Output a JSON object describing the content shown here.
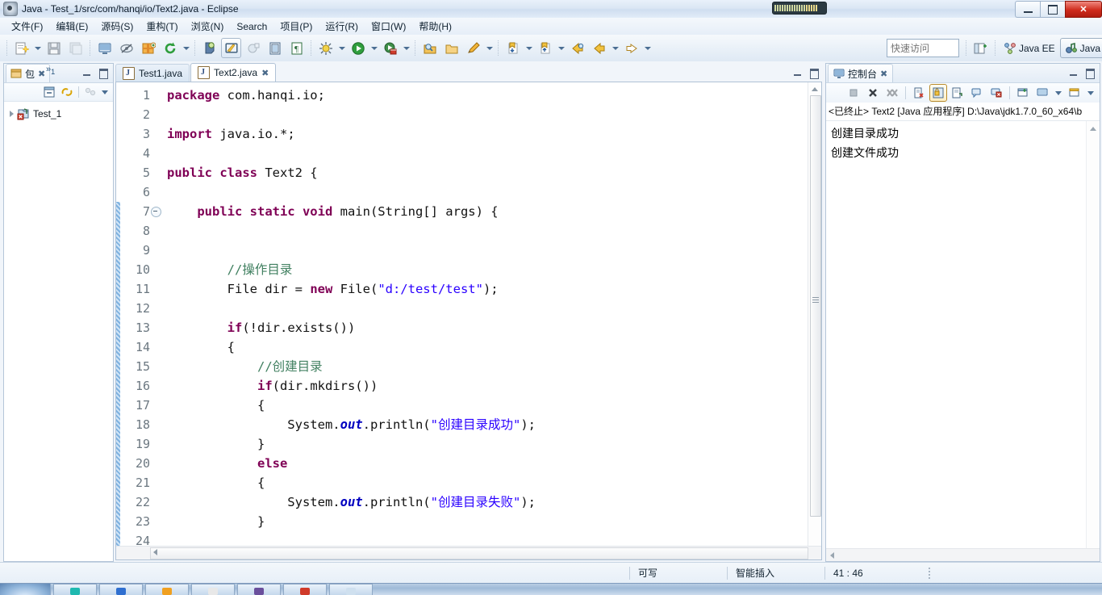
{
  "window": {
    "title": "Java - Test_1/src/com/hanqi/io/Text2.java - Eclipse",
    "app_icon": "eclipse-icon",
    "minimize_label": "Minimize",
    "restore_label": "Restore",
    "close_label": "Close"
  },
  "menubar": {
    "items": [
      {
        "label": "文件(F)",
        "name": "menu-file"
      },
      {
        "label": "编辑(E)",
        "name": "menu-edit"
      },
      {
        "label": "源码(S)",
        "name": "menu-source"
      },
      {
        "label": "重构(T)",
        "name": "menu-refactor"
      },
      {
        "label": "浏览(N)",
        "name": "menu-navigate"
      },
      {
        "label": "Search",
        "name": "menu-search"
      },
      {
        "label": "项目(P)",
        "name": "menu-project"
      },
      {
        "label": "运行(R)",
        "name": "menu-run"
      },
      {
        "label": "窗口(W)",
        "name": "menu-window"
      },
      {
        "label": "帮助(H)",
        "name": "menu-help"
      }
    ]
  },
  "toolbar": {
    "quick_access_placeholder": "快速访问",
    "quick_access_value": "",
    "open_perspective_label": "Open Perspective",
    "perspectives": [
      {
        "label": "Java EE",
        "selected": false
      },
      {
        "label": "Java",
        "selected": true
      }
    ]
  },
  "package_explorer": {
    "tab_label": "包",
    "overflow_label": "»",
    "overflow_count": "1",
    "tree": [
      {
        "label": "Test_1",
        "icon": "java-project-error-icon",
        "expanded": false
      }
    ]
  },
  "editor": {
    "tabs": [
      {
        "label": "Test1.java",
        "active": false,
        "closable": false
      },
      {
        "label": "Text2.java",
        "active": true,
        "closable": true
      }
    ],
    "first_line": 1,
    "lines": [
      {
        "n": 1,
        "folded": false,
        "changed": false,
        "tokens": [
          {
            "t": "package",
            "c": "kw"
          },
          {
            "t": " com.hanqi.io;",
            "c": ""
          }
        ]
      },
      {
        "n": 2,
        "folded": false,
        "changed": false,
        "tokens": []
      },
      {
        "n": 3,
        "folded": false,
        "changed": false,
        "tokens": [
          {
            "t": "import",
            "c": "kw"
          },
          {
            "t": " java.io.*;",
            "c": ""
          }
        ]
      },
      {
        "n": 4,
        "folded": false,
        "changed": false,
        "tokens": []
      },
      {
        "n": 5,
        "folded": false,
        "changed": false,
        "tokens": [
          {
            "t": "public class",
            "c": "kw"
          },
          {
            "t": " Text2 {",
            "c": ""
          }
        ]
      },
      {
        "n": 6,
        "folded": false,
        "changed": false,
        "tokens": []
      },
      {
        "n": 7,
        "folded": true,
        "changed": true,
        "tokens": [
          {
            "t": "    ",
            "c": ""
          },
          {
            "t": "public static void",
            "c": "kw"
          },
          {
            "t": " main(String[] args) {",
            "c": ""
          }
        ]
      },
      {
        "n": 8,
        "folded": false,
        "changed": true,
        "tokens": []
      },
      {
        "n": 9,
        "folded": false,
        "changed": true,
        "tokens": []
      },
      {
        "n": 10,
        "folded": false,
        "changed": true,
        "tokens": [
          {
            "t": "        ",
            "c": ""
          },
          {
            "t": "//操作目录",
            "c": "cm"
          }
        ]
      },
      {
        "n": 11,
        "folded": false,
        "changed": true,
        "tokens": [
          {
            "t": "        File dir = ",
            "c": ""
          },
          {
            "t": "new",
            "c": "kw"
          },
          {
            "t": " File(",
            "c": ""
          },
          {
            "t": "\"d:/test/test\"",
            "c": "str"
          },
          {
            "t": ");",
            "c": ""
          }
        ]
      },
      {
        "n": 12,
        "folded": false,
        "changed": true,
        "tokens": []
      },
      {
        "n": 13,
        "folded": false,
        "changed": true,
        "tokens": [
          {
            "t": "        ",
            "c": ""
          },
          {
            "t": "if",
            "c": "kw"
          },
          {
            "t": "(!dir.exists())",
            "c": ""
          }
        ]
      },
      {
        "n": 14,
        "folded": false,
        "changed": true,
        "tokens": [
          {
            "t": "        {",
            "c": ""
          }
        ]
      },
      {
        "n": 15,
        "folded": false,
        "changed": true,
        "tokens": [
          {
            "t": "            ",
            "c": ""
          },
          {
            "t": "//创建目录",
            "c": "cm"
          }
        ]
      },
      {
        "n": 16,
        "folded": false,
        "changed": true,
        "tokens": [
          {
            "t": "            ",
            "c": ""
          },
          {
            "t": "if",
            "c": "kw"
          },
          {
            "t": "(dir.mkdirs())",
            "c": ""
          }
        ]
      },
      {
        "n": 17,
        "folded": false,
        "changed": true,
        "tokens": [
          {
            "t": "            {",
            "c": ""
          }
        ]
      },
      {
        "n": 18,
        "folded": false,
        "changed": true,
        "tokens": [
          {
            "t": "                System.",
            "c": ""
          },
          {
            "t": "out",
            "c": "fld"
          },
          {
            "t": ".println(",
            "c": ""
          },
          {
            "t": "\"创建目录成功\"",
            "c": "str"
          },
          {
            "t": ");",
            "c": ""
          }
        ]
      },
      {
        "n": 19,
        "folded": false,
        "changed": true,
        "tokens": [
          {
            "t": "            }",
            "c": ""
          }
        ]
      },
      {
        "n": 20,
        "folded": false,
        "changed": true,
        "tokens": [
          {
            "t": "            ",
            "c": ""
          },
          {
            "t": "else",
            "c": "kw"
          }
        ]
      },
      {
        "n": 21,
        "folded": false,
        "changed": true,
        "tokens": [
          {
            "t": "            {",
            "c": ""
          }
        ]
      },
      {
        "n": 22,
        "folded": false,
        "changed": true,
        "tokens": [
          {
            "t": "                System.",
            "c": ""
          },
          {
            "t": "out",
            "c": "fld"
          },
          {
            "t": ".println(",
            "c": ""
          },
          {
            "t": "\"创建目录失败\"",
            "c": "str"
          },
          {
            "t": ");",
            "c": ""
          }
        ]
      },
      {
        "n": 23,
        "folded": false,
        "changed": true,
        "tokens": [
          {
            "t": "            }",
            "c": ""
          }
        ]
      },
      {
        "n": 24,
        "folded": false,
        "changed": true,
        "tokens": []
      }
    ]
  },
  "console": {
    "tab_label": "控制台",
    "status_line": "<已终止> Text2 [Java 应用程序] D:\\Java\\jdk1.7.0_60_x64\\b",
    "output": [
      "创建目录成功",
      "创建文件成功"
    ],
    "toolbar_icons": [
      "stop-icon",
      "terminate-icon",
      "remove-all-terminated-icon",
      "clear-console-icon",
      "scroll-lock-icon",
      "word-wrap-icon",
      "show-console-on-output-icon",
      "show-console-on-error-icon",
      "pin-console-icon",
      "display-selected-console-icon",
      "new-console-view-icon"
    ]
  },
  "statusbar": {
    "writable": "可写",
    "insert_mode": "智能插入",
    "position": "41 : 46"
  },
  "colors": {
    "keyword": "#7f0055",
    "string": "#2a00ff",
    "comment": "#3f7f5f",
    "static_field": "#0000c0",
    "changed_bar": "#7fb2e0",
    "close_button": "#cf2b1c"
  }
}
